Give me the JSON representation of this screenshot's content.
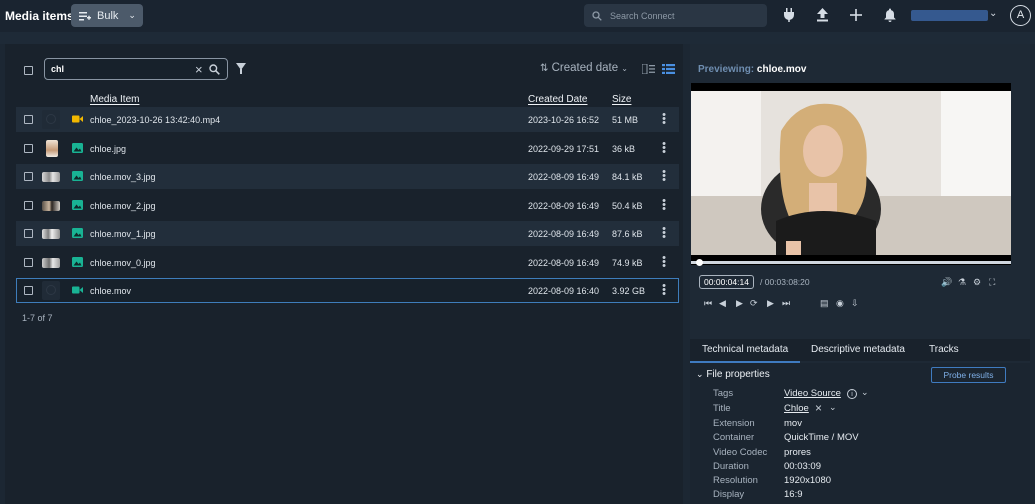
{
  "header": {
    "title": "Media items",
    "bulk_label": "Bulk",
    "search_placeholder": "Search Connect"
  },
  "toolbar": {
    "filter_value": "chl",
    "sort_label": "Created date"
  },
  "table": {
    "columns": [
      "Media Item",
      "Created Date",
      "Size"
    ],
    "rows": [
      {
        "name": "chloe_2023-10-26 13:42:40.mp4",
        "date": "2023-10-26 16:52",
        "size": "51 MB",
        "icon": "video-icon-yellow"
      },
      {
        "name": "chloe.jpg",
        "date": "2022-09-29 17:51",
        "size": "36 kB",
        "icon": "image-icon"
      },
      {
        "name": "chloe.mov_3.jpg",
        "date": "2022-08-09 16:49",
        "size": "84.1 kB",
        "icon": "image-icon"
      },
      {
        "name": "chloe.mov_2.jpg",
        "date": "2022-08-09 16:49",
        "size": "50.4 kB",
        "icon": "image-icon"
      },
      {
        "name": "chloe.mov_1.jpg",
        "date": "2022-08-09 16:49",
        "size": "87.6 kB",
        "icon": "image-icon"
      },
      {
        "name": "chloe.mov_0.jpg",
        "date": "2022-08-09 16:49",
        "size": "74.9 kB",
        "icon": "image-icon"
      },
      {
        "name": "chloe.mov",
        "date": "2022-08-09 16:40",
        "size": "3.92 GB",
        "icon": "video-icon-green"
      }
    ],
    "pager": "1-7 of 7"
  },
  "preview": {
    "label": "Previewing:",
    "filename": "chloe.mov",
    "timecode": "00:00:04:14",
    "duration": "/ 00:03:08:20",
    "playback_progress": 0.02
  },
  "tabs": [
    "Technical metadata",
    "Descriptive metadata",
    "Tracks"
  ],
  "properties": {
    "section_title": "File properties",
    "probe_label": "Probe results",
    "items": [
      {
        "label": "Tags",
        "value": "Video Source"
      },
      {
        "label": "Title",
        "value": "Chloe"
      },
      {
        "label": "Extension",
        "value": "mov"
      },
      {
        "label": "Container",
        "value": "QuickTime / MOV"
      },
      {
        "label": "Video Codec",
        "value": "prores"
      },
      {
        "label": "Duration",
        "value": "00:03:09"
      },
      {
        "label": "Resolution",
        "value": "1920x1080"
      },
      {
        "label": "Display",
        "value": "16:9"
      }
    ]
  },
  "colors": {
    "accent": "#3f7bc0",
    "image_icon": "#19b394",
    "video_icon_yellow": "#f2b800",
    "video_icon_green": "#19b394"
  }
}
